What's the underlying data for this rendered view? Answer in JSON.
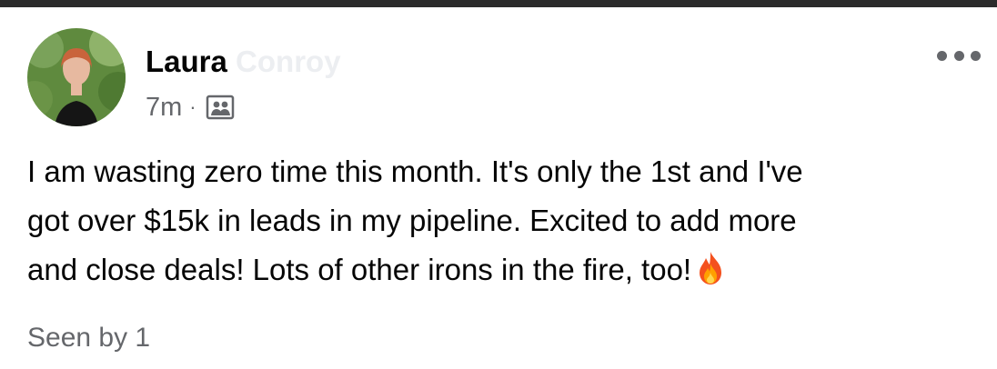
{
  "post": {
    "author": {
      "first_name": "Laura",
      "last_name_obscured": "Conroy"
    },
    "timestamp": "7m",
    "separator": "·",
    "audience_icon": "group-audience-icon",
    "more_icon": "more-options-icon",
    "text_lines": [
      "I am wasting zero time this month. It's only the 1st and I've",
      "got over $15k in leads in my pipeline. Excited to add more",
      "and close deals! Lots of other irons in the fire, too!"
    ],
    "trailing_emoji": "fire-emoji-icon",
    "seen_by": "Seen by 1"
  },
  "colors": {
    "text_primary": "#050505",
    "text_secondary": "#65676b",
    "border_top": "#2b2b2b"
  }
}
